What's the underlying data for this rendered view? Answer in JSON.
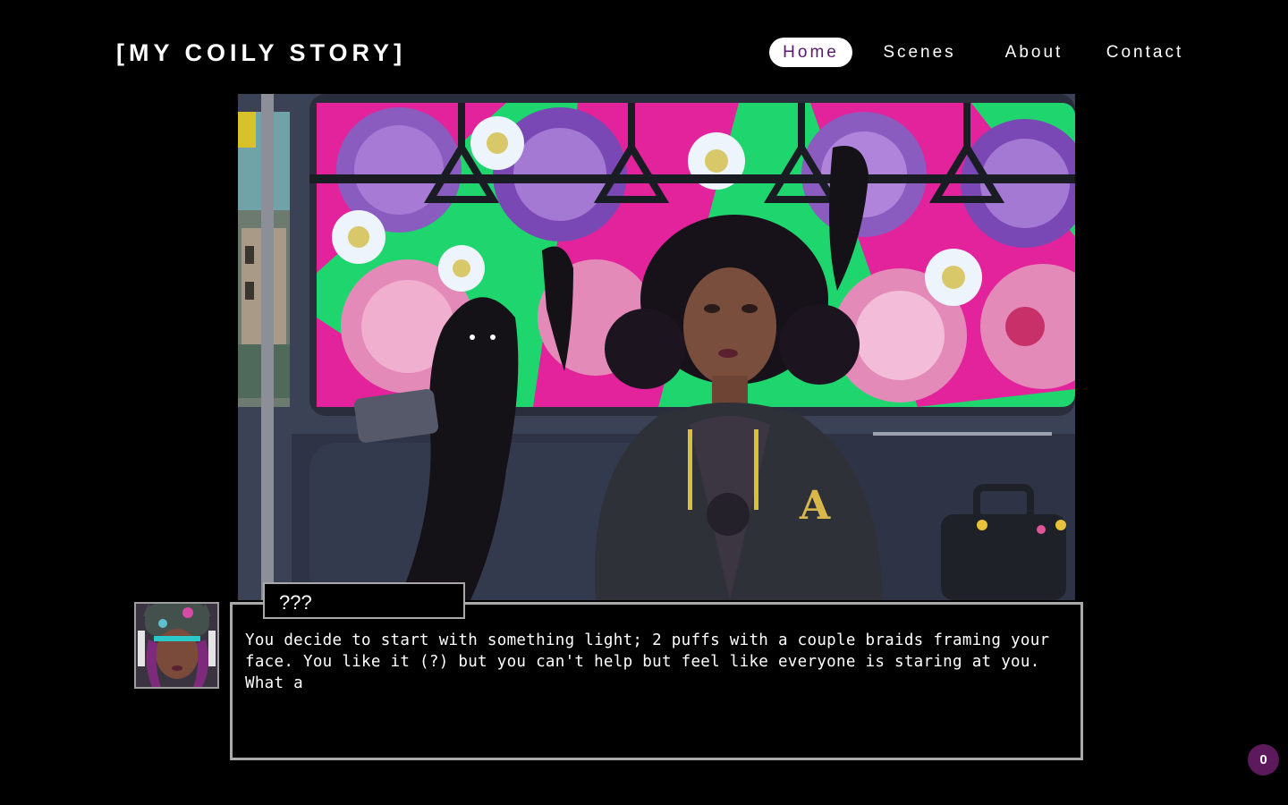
{
  "brand": {
    "title": "[MY COILY STORY]"
  },
  "nav": {
    "items": [
      {
        "label": "Home",
        "active": true
      },
      {
        "label": "Scenes",
        "active": false
      },
      {
        "label": "About",
        "active": false
      },
      {
        "label": "Contact",
        "active": false
      }
    ]
  },
  "scene": {
    "description_icon": "subway-scene-image",
    "jacket_letter": "A"
  },
  "dialog": {
    "speaker": "???",
    "text": "You decide to start with something light; 2 puffs with a couple braids framing your face. You like it (?) but you can't help but feel like everyone is staring at you. What a"
  },
  "counter": {
    "value": "0"
  },
  "colors": {
    "accent": "#5c1a5c",
    "nav_active_text": "#5a1a6e",
    "window_green": "#2ee07a",
    "window_pink": "#e0249a"
  }
}
